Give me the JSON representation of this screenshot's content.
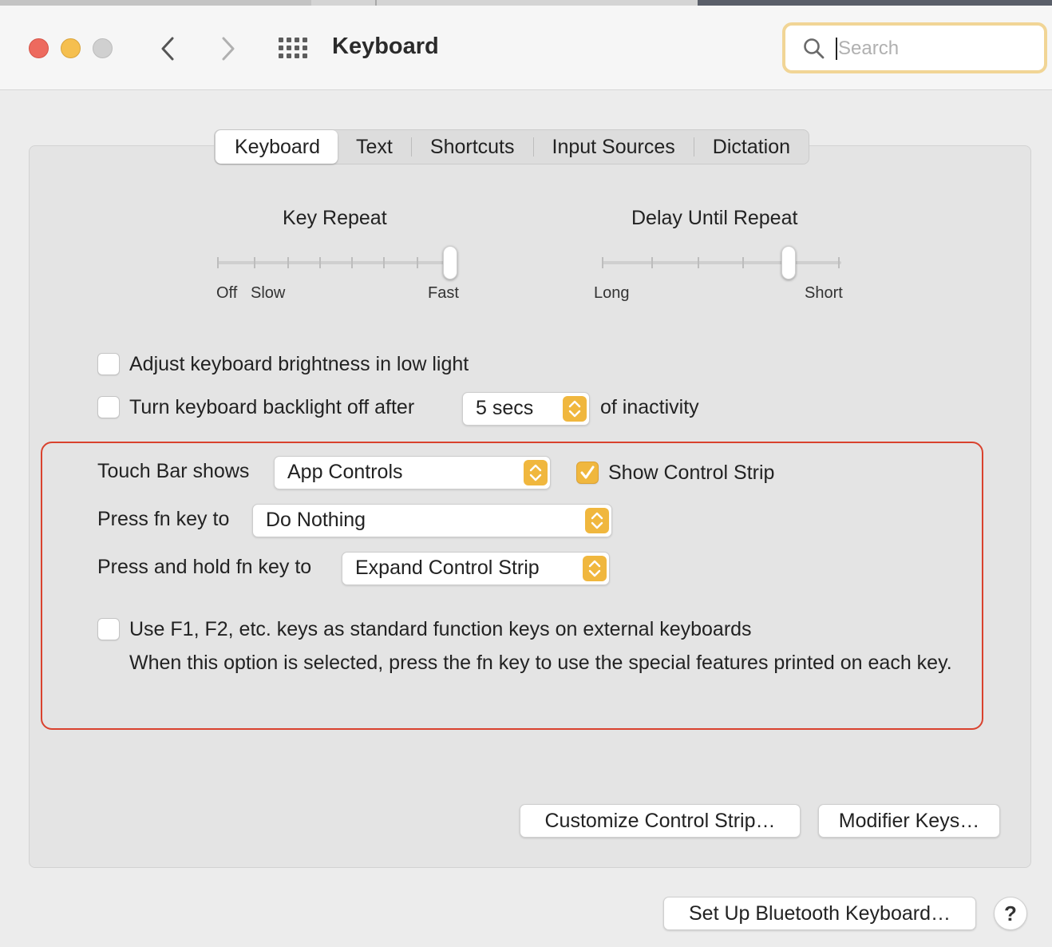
{
  "window": {
    "title": "Keyboard"
  },
  "search": {
    "placeholder": "Search",
    "value": ""
  },
  "tabs": [
    {
      "label": "Keyboard",
      "active": true
    },
    {
      "label": "Text",
      "active": false
    },
    {
      "label": "Shortcuts",
      "active": false
    },
    {
      "label": "Input Sources",
      "active": false
    },
    {
      "label": "Dictation",
      "active": false
    }
  ],
  "key_repeat": {
    "title": "Key Repeat",
    "labels": [
      "Off",
      "Slow",
      "Fast"
    ],
    "ticks": 8,
    "selected_step": 7
  },
  "delay_until_repeat": {
    "title": "Delay Until Repeat",
    "labels": [
      "Long",
      "Short"
    ],
    "ticks": 6,
    "selected_step": 4
  },
  "options": {
    "adjust_brightness": {
      "label": "Adjust keyboard brightness in low light",
      "checked": false
    },
    "backlight_off": {
      "label": "Turn keyboard backlight off after",
      "checked": false,
      "value": "5 secs",
      "suffix": "of inactivity"
    }
  },
  "touch_bar": {
    "shows_label": "Touch Bar shows",
    "shows_value": "App Controls",
    "control_strip_label": "Show Control Strip",
    "control_strip_checked": true,
    "fn_label": "Press fn key to",
    "fn_value": "Do Nothing",
    "hold_fn_label": "Press and hold fn key to",
    "hold_fn_value": "Expand Control Strip"
  },
  "function_keys": {
    "label": "Use F1, F2, etc. keys as standard function keys on external keyboards",
    "description": "When this option is selected, press the fn key to use the special features printed on each key.",
    "checked": false
  },
  "buttons": {
    "customize": "Customize Control Strip…",
    "modifier": "Modifier Keys…",
    "bluetooth": "Set Up Bluetooth Keyboard…",
    "help": "?"
  },
  "colors": {
    "accent": "#f0b73e",
    "highlight_border": "#d9422e"
  }
}
